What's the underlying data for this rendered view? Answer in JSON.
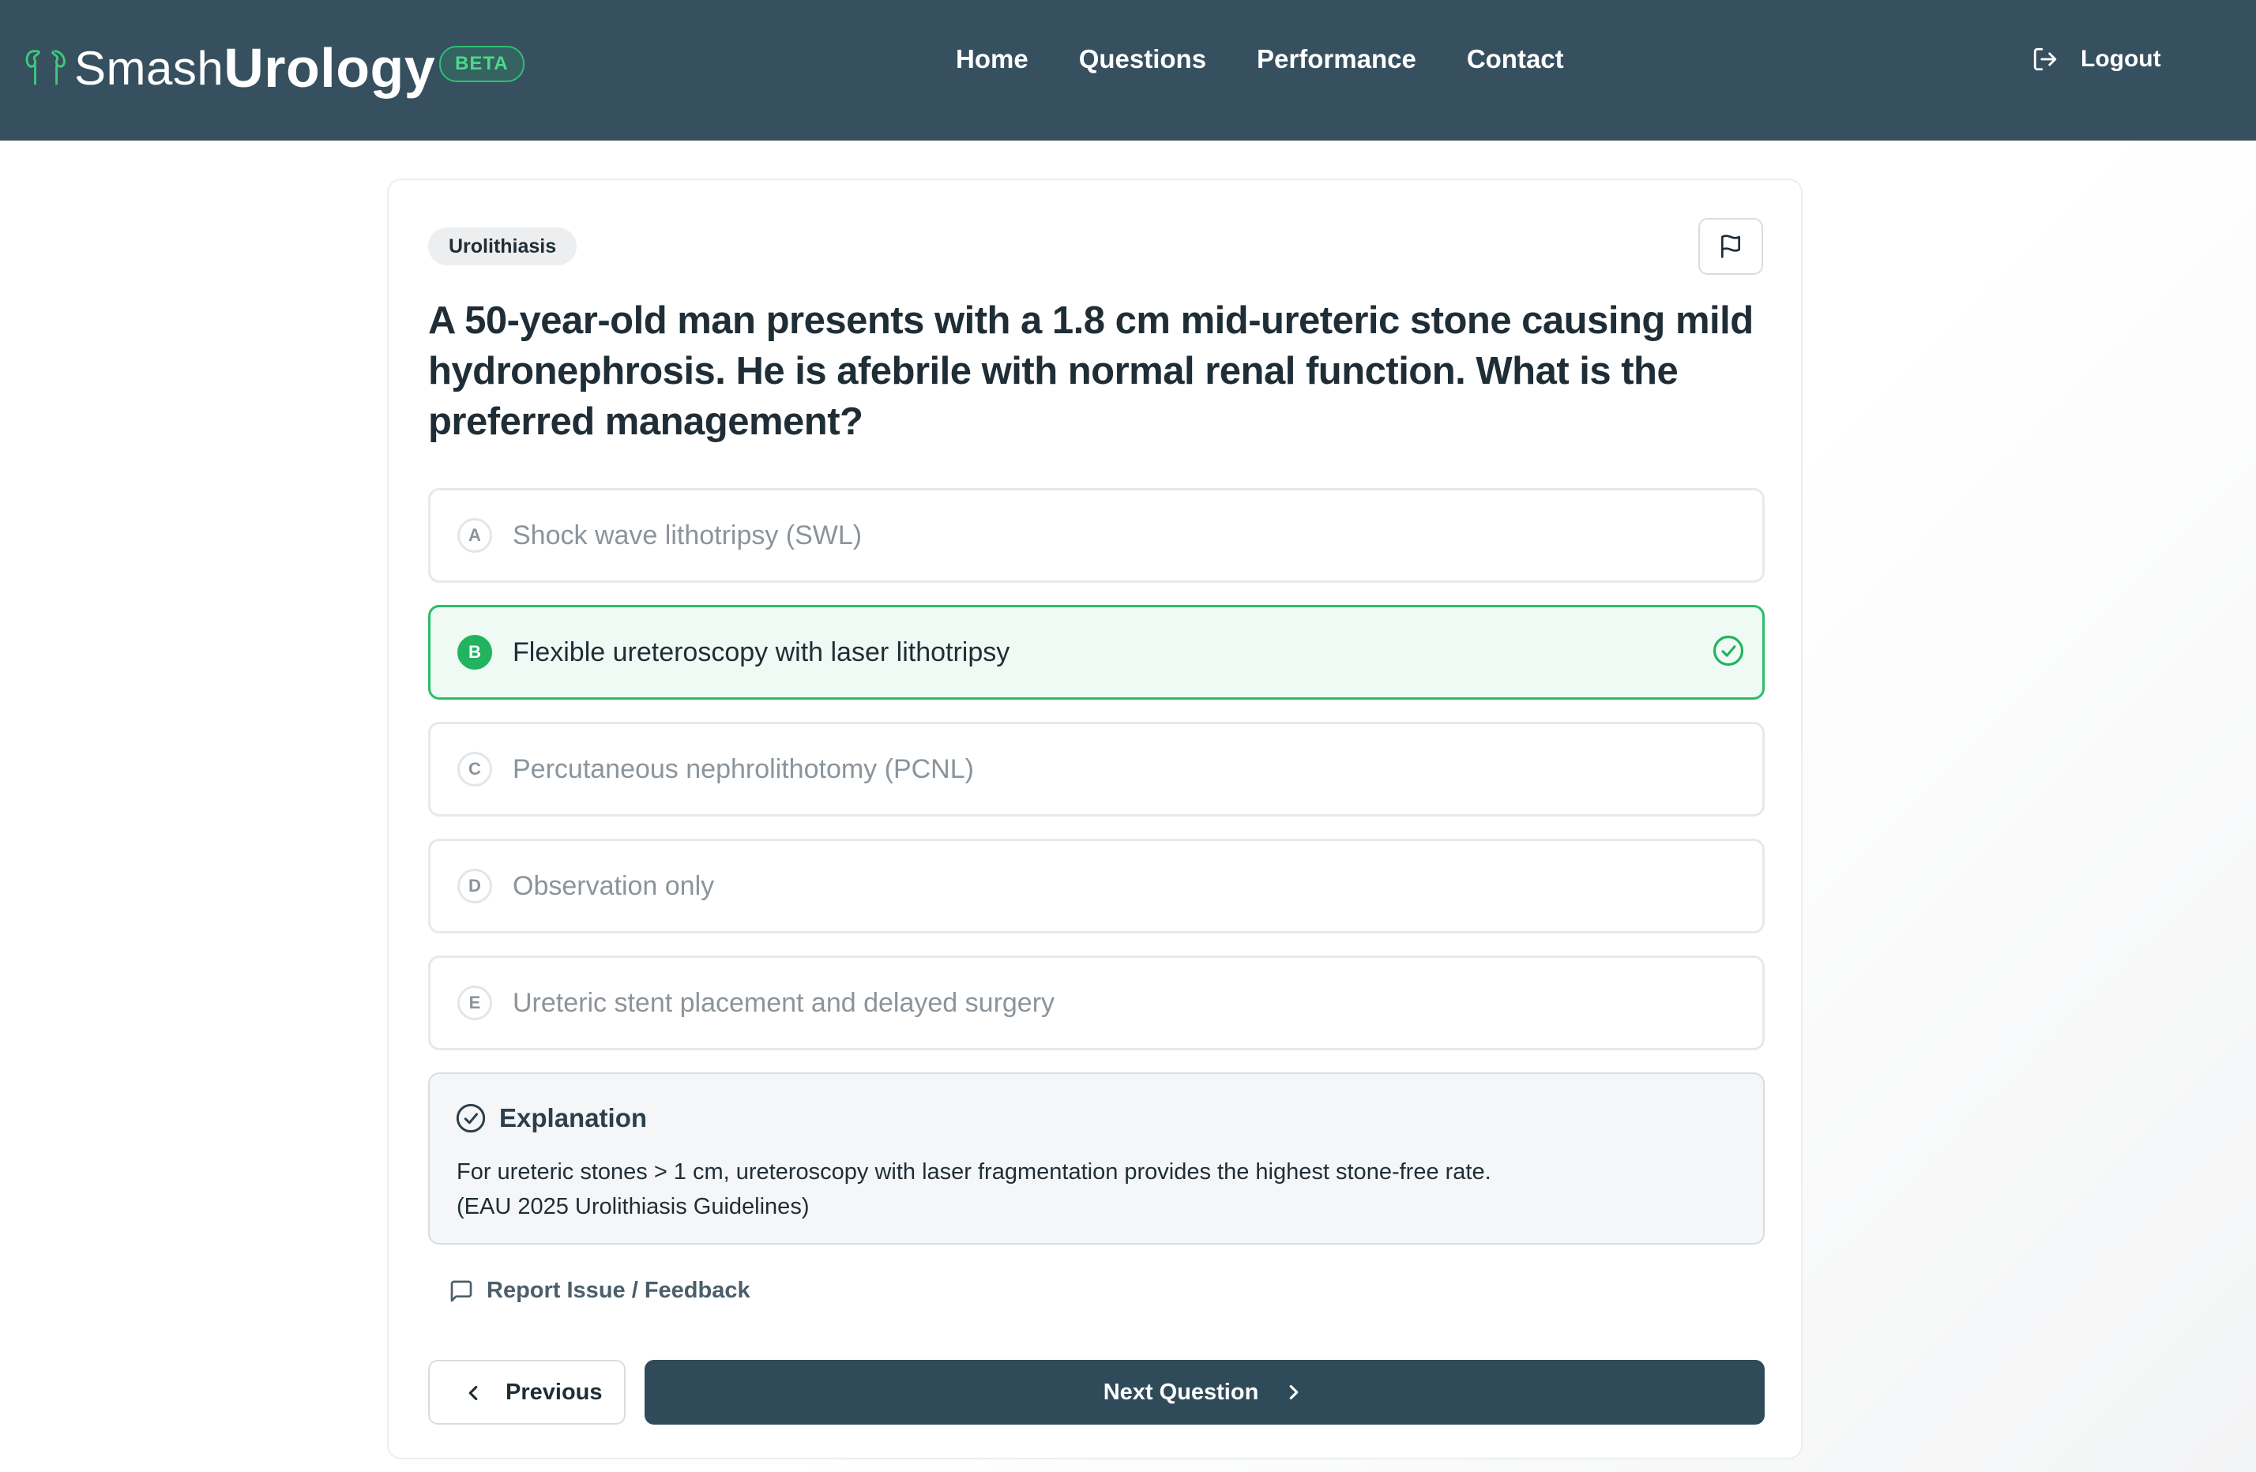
{
  "header": {
    "brand_light": "Smash",
    "brand_bold": "Urology",
    "beta_badge": "BETA",
    "nav": [
      "Home",
      "Questions",
      "Performance",
      "Contact"
    ],
    "logout_label": "Logout"
  },
  "question": {
    "topic": "Urolithiasis",
    "text": "A 50-year-old man presents with a 1.8 cm mid-ureteric stone causing mild hydronephrosis. He is afebrile with normal renal function. What is the preferred management?",
    "options": [
      {
        "letter": "A",
        "text": "Shock wave lithotripsy (SWL)",
        "state": "dimmed"
      },
      {
        "letter": "B",
        "text": "Flexible ureteroscopy with laser lithotripsy",
        "state": "correct"
      },
      {
        "letter": "C",
        "text": "Percutaneous nephrolithotomy (PCNL)",
        "state": "dimmed"
      },
      {
        "letter": "D",
        "text": "Observation only",
        "state": "dimmed"
      },
      {
        "letter": "E",
        "text": "Ureteric stent placement and delayed surgery",
        "state": "dimmed"
      }
    ]
  },
  "explanation": {
    "title": "Explanation",
    "line1": "For ureteric stones > 1 cm, ureteroscopy with laser fragmentation provides the highest stone-free rate.",
    "line2": "(EAU 2025 Urolithiasis Guidelines)"
  },
  "actions": {
    "report_label": "Report Issue / Feedback",
    "previous_label": "Previous",
    "next_label": "Next Question"
  },
  "colors": {
    "header_bg": "#36505f",
    "correct_green": "#22b35f",
    "primary_button": "#2f4b5a"
  }
}
